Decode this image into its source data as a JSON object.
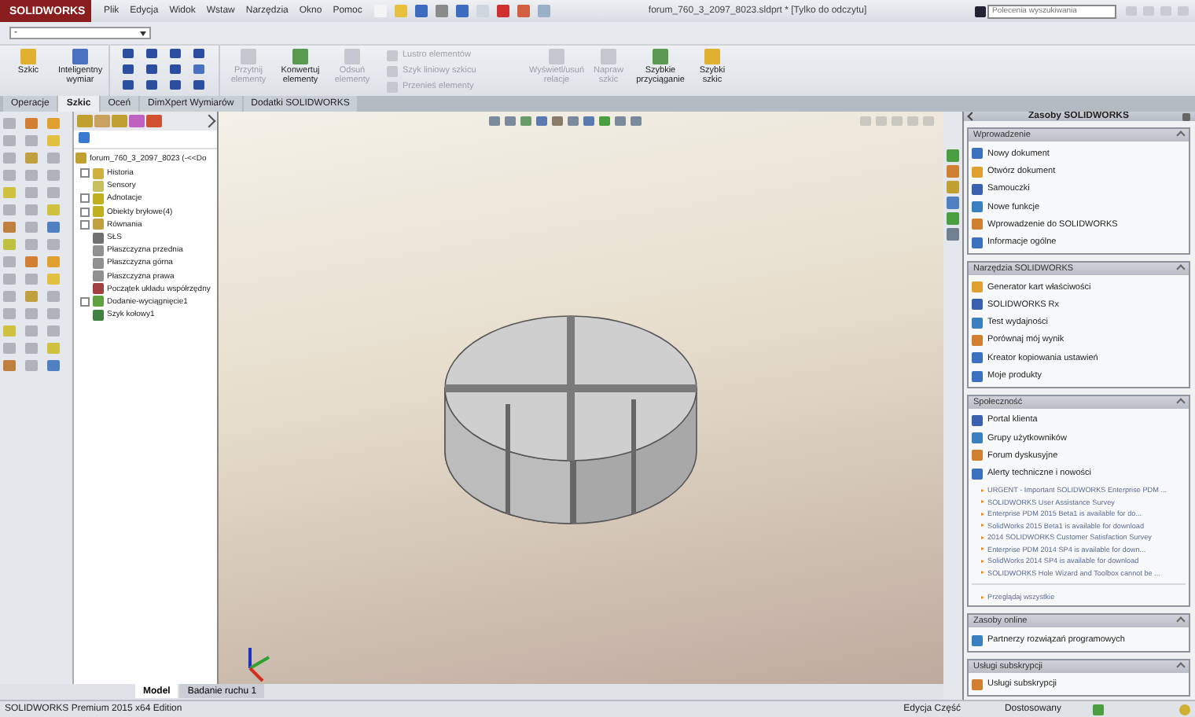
{
  "window": {
    "logo": "SOLIDWORKS",
    "title": "forum_760_3_2097_8023.sldprt * [Tylko do odczytu]"
  },
  "menu": [
    "Plik",
    "Edycja",
    "Widok",
    "Wstaw",
    "Narzędzia",
    "Okno",
    "Pomoc"
  ],
  "search": {
    "placeholder": "Polecenia wyszukiwania"
  },
  "command_combo": {
    "value": "-"
  },
  "ribbon": [
    {
      "kind": "large",
      "label": "Szkic",
      "disabled": false
    },
    {
      "kind": "large",
      "label": "Inteligentny wymiar",
      "disabled": false
    },
    {
      "kind": "tools"
    },
    {
      "kind": "large",
      "label": "Przytnij elementy",
      "disabled": true
    },
    {
      "kind": "large",
      "label": "Konwertuj elementy",
      "disabled": false
    },
    {
      "kind": "large",
      "label": "Odsuń elementy",
      "disabled": true
    },
    {
      "kind": "small",
      "items": [
        {
          "label": "Lustro elementów",
          "disabled": true
        },
        {
          "label": "Szyk liniowy szkicu",
          "disabled": true
        },
        {
          "label": "Przenieś elementy",
          "disabled": true
        }
      ]
    },
    {
      "kind": "large",
      "label": "Wyświetl/usuń relacje",
      "disabled": true
    },
    {
      "kind": "large",
      "label": "Napraw szkic",
      "disabled": true
    },
    {
      "kind": "large",
      "label": "Szybkie przyciąganie",
      "disabled": false
    },
    {
      "kind": "large",
      "label": "Szybki szkic",
      "disabled": false
    }
  ],
  "tabs": [
    {
      "label": "Operacje",
      "selected": false
    },
    {
      "label": "Szkic",
      "selected": true
    },
    {
      "label": "Oceń",
      "selected": false
    },
    {
      "label": "DimXpert Wymiarów",
      "selected": false
    },
    {
      "label": "Dodatki SOLIDWORKS",
      "selected": false
    }
  ],
  "tree": {
    "root": "forum_760_3_2097_8023  (-<<Do",
    "items": [
      {
        "label": "Historia",
        "collapsed": true
      },
      {
        "label": "Sensory",
        "collapsed": false
      },
      {
        "label": "Adnotacje",
        "collapsed": true
      },
      {
        "label": "Obiekty bryłowe(4)",
        "collapsed": true
      },
      {
        "label": "Równania",
        "collapsed": true
      },
      {
        "label": "SŁS",
        "collapsed": false
      },
      {
        "label": "Płaszczyzna przednia",
        "collapsed": false
      },
      {
        "label": "Płaszczyzna górna",
        "collapsed": false
      },
      {
        "label": "Płaszczyzna prawa",
        "collapsed": false
      },
      {
        "label": "Początek układu współrzędny",
        "collapsed": false
      },
      {
        "label": "Dodanie-wyciągnięcie1",
        "collapsed": true
      },
      {
        "label": "Szyk kołowy1",
        "collapsed": false
      }
    ]
  },
  "bottom_tabs": [
    {
      "label": "Model",
      "selected": true
    },
    {
      "label": "Badanie ruchu 1",
      "selected": false
    }
  ],
  "task_pane": {
    "title": "Zasoby SOLIDWORKS",
    "sections": [
      {
        "title": "Wprowadzenie",
        "items": [
          "Nowy dokument",
          "Otwórz dokument",
          "Samouczki",
          "Nowe funkcje",
          "Wprowadzenie do SOLIDWORKS",
          "Informacje ogólne"
        ]
      },
      {
        "title": "Narzędzia SOLIDWORKS",
        "items": [
          "Generator kart właściwości",
          "SOLIDWORKS Rx",
          "Test wydajności",
          "Porównaj mój wynik",
          "Kreator kopiowania ustawień",
          "Moje produkty"
        ]
      },
      {
        "title": "Społeczność",
        "items": [
          "Portal klienta",
          "Grupy użytkowników",
          "Forum dyskusyjne",
          "Alerty techniczne i nowości"
        ],
        "news": [
          "URGENT - Important SOLIDWORKS Enterprise PDM ...",
          "SOLIDWORKS User Assistance Survey",
          "Enterprise PDM 2015 Beta1 is available for do...",
          "SolidWorks 2015 Beta1 is available for download",
          "2014 SOLIDWORKS Customer Satisfaction Survey",
          "Enterprise PDM 2014 SP4 is available for down...",
          "SolidWorks 2014 SP4 is available for download",
          "SOLIDWORKS Hole Wizard and Toolbox cannot be ..."
        ],
        "more": "Przeglądaj wszystkie"
      },
      {
        "title": "Zasoby online",
        "items": [
          "Partnerzy rozwiązań programowych"
        ]
      },
      {
        "title": "Usługi subskrypcji",
        "items": [
          "Usługi subskrypcji"
        ]
      }
    ]
  },
  "status_bar": {
    "product": "SOLIDWORKS Premium 2015 x64 Edition",
    "mode": "Edycja Część",
    "units": "Dostosowany"
  }
}
